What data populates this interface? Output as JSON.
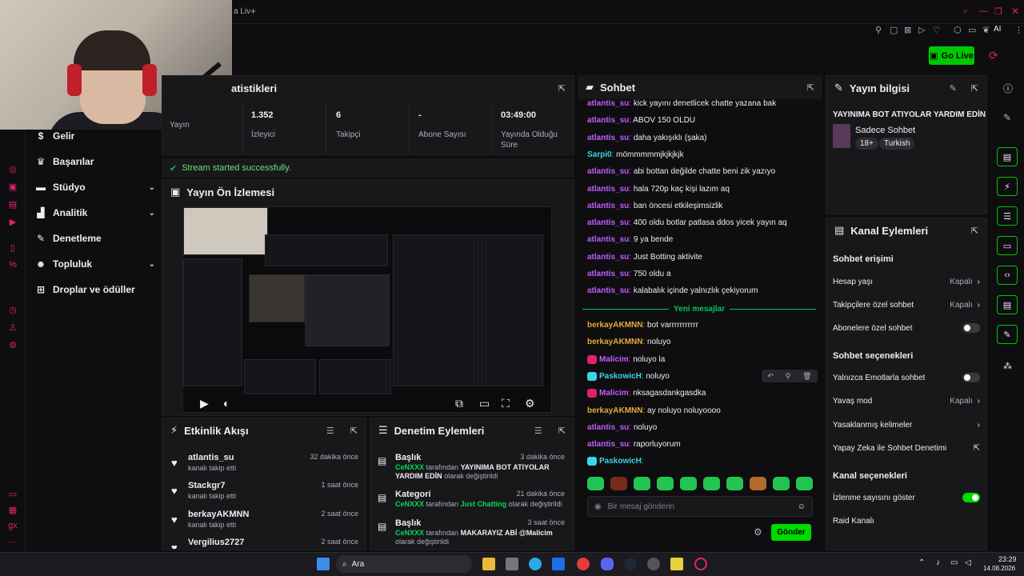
{
  "topbar": {
    "tab_title": "a Liv",
    "new_tab": "+"
  },
  "toolbar": {
    "go_live_label": "Go Live",
    "ai_label": "AI"
  },
  "sidenav": {
    "items": [
      {
        "label": "Gelir",
        "icon": "dollar-icon",
        "has_chevron": false
      },
      {
        "label": "Başarılar",
        "icon": "trophy-icon",
        "has_chevron": false
      },
      {
        "label": "Stüdyo",
        "icon": "studio-icon",
        "has_chevron": true
      },
      {
        "label": "Analitik",
        "icon": "chart-icon",
        "has_chevron": true
      },
      {
        "label": "Denetleme",
        "icon": "wrench-icon",
        "has_chevron": false
      },
      {
        "label": "Topluluk",
        "icon": "people-icon",
        "has_chevron": true
      },
      {
        "label": "Droplar ve ödüller",
        "icon": "drops-icon",
        "has_chevron": false
      }
    ]
  },
  "stats": {
    "title": "atistikleri",
    "cells": [
      {
        "value": "",
        "label": "Yayın"
      },
      {
        "value": "1.352",
        "label": "İzleyici"
      },
      {
        "value": "6",
        "label": "Takipçi"
      },
      {
        "value": "-",
        "label": "Abone Sayısı"
      },
      {
        "value": "03:49:00",
        "label": "Yayında Olduğu Süre"
      }
    ]
  },
  "success_message": "Stream started successfully.",
  "preview": {
    "title": "Yayın Ön İzlemesi"
  },
  "activity": {
    "title": "Etkinlik Akışı",
    "rows": [
      {
        "name": "atlantis_su",
        "sub": "kanalı takip etti",
        "time": "32 dakika önce"
      },
      {
        "name": "Stackgr7",
        "sub": "kanalı takip etti",
        "time": "1 saat önce"
      },
      {
        "name": "berkayAKMNN",
        "sub": "kanalı takip etti",
        "time": "2 saat önce"
      },
      {
        "name": "Vergilius2727",
        "sub": "",
        "time": "2 saat önce"
      }
    ]
  },
  "modactions": {
    "title": "Denetim Eylemleri",
    "rows": [
      {
        "type": "Başlık",
        "time": "3 dakika önce",
        "by": "CeNXXX",
        "mid": "tarafından",
        "value": "YAYINIMA BOT ATIYOLAR YARDIM EDİN",
        "end": "olarak değiştirildi"
      },
      {
        "type": "Kategori",
        "time": "21 dakika önce",
        "by": "CeNXXX",
        "mid": "tarafından",
        "value": "Just Chatting",
        "end": "olarak değiştirildi"
      },
      {
        "type": "Başlık",
        "time": "3 saat önce",
        "by": "CeNXXX",
        "mid": "tarafından",
        "value": "MAKARAYIZ ABİ @Malicim",
        "end": "olarak değiştirildi"
      }
    ]
  },
  "chat": {
    "title": "Sohbet",
    "new_messages_label": "Yeni mesajlar",
    "messages_old": [
      {
        "user": "atlantis_su",
        "color": "#c15cff",
        "text": "kick yayını denetlicek chatte yazana bak"
      },
      {
        "user": "atlantis_su",
        "color": "#c15cff",
        "text": "ABOV 150 OLDU"
      },
      {
        "user": "atlantis_su",
        "color": "#c15cff",
        "text": "daha yakışıklı (şaka)"
      },
      {
        "user": "Sarpi0",
        "color": "#3ad5e8",
        "text": "mömmmmmjkjkjkjk"
      },
      {
        "user": "atlantis_su",
        "color": "#c15cff",
        "text": "abi bottan değilde chatte beni zik yazıyo"
      },
      {
        "user": "atlantis_su",
        "color": "#c15cff",
        "text": "hala 720p kaç kişi lazım aq"
      },
      {
        "user": "atlantis_su",
        "color": "#c15cff",
        "text": "ban öncesi etkileşimsizlik"
      },
      {
        "user": "atlantis_su",
        "color": "#c15cff",
        "text": "400 oldu botlar patlasa ddos yicek yayın aq"
      },
      {
        "user": "atlantis_su",
        "color": "#c15cff",
        "text": "9 ya bende"
      },
      {
        "user": "atlantis_su",
        "color": "#c15cff",
        "text": "Just Botting aktivite"
      },
      {
        "user": "atlantis_su",
        "color": "#c15cff",
        "text": "750 oldu a"
      },
      {
        "user": "atlantis_su",
        "color": "#c15cff",
        "text": "kalabalık içinde yalnızlık çekiyorum"
      }
    ],
    "messages_new": [
      {
        "user": "berkayAKMNN",
        "color": "#e8a93a",
        "text": "bot varrrrrrrrrrr",
        "badge": ""
      },
      {
        "user": "berkayAKMNN",
        "color": "#e8a93a",
        "text": "noluyo",
        "badge": ""
      },
      {
        "user": "Malicim",
        "color": "#c15cff",
        "text": "noluyo la",
        "badge": "pink"
      },
      {
        "user": "PaskowicH",
        "color": "#3ad5e8",
        "text": "noluyo",
        "badge": "blue"
      },
      {
        "user": "Malicim",
        "color": "#c15cff",
        "text": "nksagasdankgasdka",
        "badge": "pink"
      },
      {
        "user": "berkayAKMNN",
        "color": "#e8a93a",
        "text": "ay noluyo noluyoooo",
        "badge": ""
      },
      {
        "user": "atlantis_su",
        "color": "#c15cff",
        "text": "noluyo",
        "badge": ""
      },
      {
        "user": "atlantis_su",
        "color": "#c15cff",
        "text": "raporluyorum",
        "badge": ""
      },
      {
        "user": "PaskowicH",
        "color": "#3ad5e8",
        "text": "",
        "badge": "blue"
      }
    ],
    "input_placeholder": "Bir mesaj gönderin",
    "send_label": "Gönder"
  },
  "streaminfo": {
    "title": "Yayın bilgisi",
    "stream_title": "YAYINIMA BOT ATIYOLAR YARDIM EDİN",
    "category": "Sadece Sohbet",
    "tags": [
      "18+",
      "Turkish"
    ]
  },
  "channelactions": {
    "title": "Kanal Eylemleri",
    "section_chat_access": "Sohbet erişimi",
    "age_label": "Hesap yaşı",
    "age_value": "Kapalı",
    "followers_label": "Takipçilere özel sohbet",
    "followers_value": "Kapalı",
    "subs_label": "Abonelere özel sohbet",
    "section_chat_options": "Sohbet seçenekleri",
    "emote_label": "Yalnızca Emotlarla sohbet",
    "slow_label": "Yavaş mod",
    "slow_value": "Kapalı",
    "banned_words_label": "Yasaklanmış kelimeler",
    "ai_mod_label": "Yapay Zeka ile Sohbet Denetimi",
    "section_channel_options": "Kanal seçenekleri",
    "viewcount_label": "İzlenme sayısını göster",
    "raid_label": "Raid Kanalı"
  },
  "taskbar": {
    "search_label": "Ara",
    "time": "23:29",
    "date": "14.08.2026"
  }
}
